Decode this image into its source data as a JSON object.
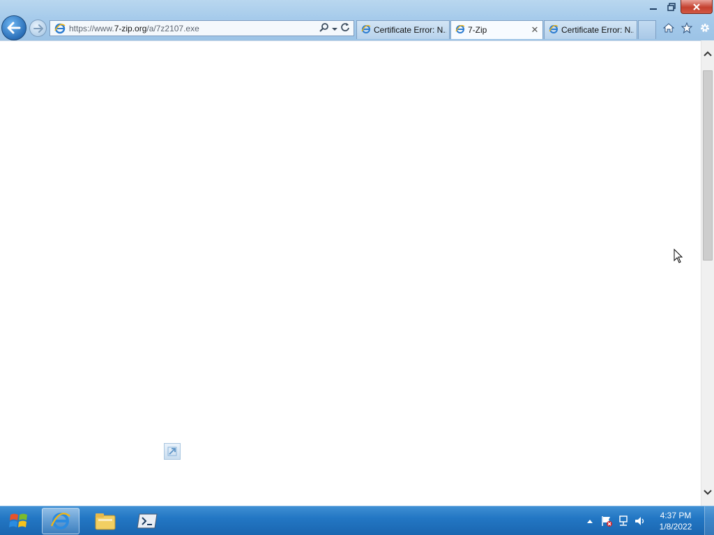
{
  "browser": {
    "address": {
      "prefix": "https://www.",
      "domain": "7-zip.org",
      "path": "/a/7z2107.exe"
    },
    "tabs": [
      {
        "label": "Certificate Error: N...",
        "active": false
      },
      {
        "label": "7-Zip",
        "active": true,
        "close": "✕"
      },
      {
        "label": "Certificate Error: N...",
        "active": false
      }
    ],
    "window_buttons": {
      "minimize": "—",
      "restore": "❐",
      "close": "✕"
    }
  },
  "taskbar": {
    "apps": [
      "internet-explorer",
      "file-explorer",
      "powershell"
    ],
    "clock": {
      "time": "4:37 PM",
      "date": "1/8/2022"
    }
  },
  "colors": {
    "accent": "#2377c4",
    "chrome": "#a6cbeb"
  }
}
